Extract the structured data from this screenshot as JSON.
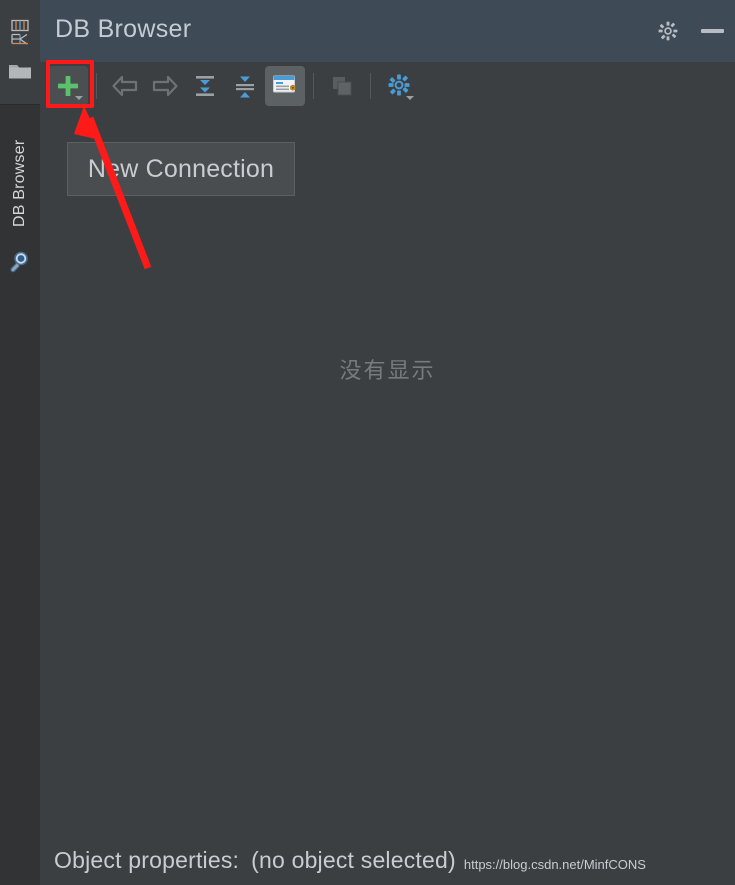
{
  "window": {
    "title": "DB Browser",
    "settings_icon": "gear-icon",
    "minimize_icon": "minimize-icon",
    "background": "#3c3f41",
    "titlebar_background": "#3f4a57"
  },
  "activity_bar": {
    "items": [
      {
        "icon": "database-tool-icon",
        "label": "Database"
      },
      {
        "icon": "folder-icon",
        "label": "Project Files"
      },
      {
        "icon": "search-everywhere-icon",
        "label": "Search"
      }
    ],
    "vertical_label": "DB Browser"
  },
  "toolbar": {
    "buttons": [
      {
        "id": "new-connection",
        "icon": "plus-icon",
        "label": "New Connection",
        "has_dropdown": true,
        "enabled": true,
        "state": "raised"
      },
      {
        "id": "separator-1",
        "icon": "separator",
        "label": ""
      },
      {
        "id": "back",
        "icon": "arrow-left-icon",
        "label": "Back",
        "enabled": false
      },
      {
        "id": "forward",
        "icon": "arrow-right-icon",
        "label": "Forward",
        "enabled": false
      },
      {
        "id": "expand-all",
        "icon": "expand-all-icon",
        "label": "Expand All",
        "enabled": true
      },
      {
        "id": "collapse-all",
        "icon": "collapse-all-icon",
        "label": "Collapse All",
        "enabled": true
      },
      {
        "id": "object-properties",
        "icon": "properties-window-icon",
        "label": "Object Properties",
        "enabled": true,
        "state": "active"
      },
      {
        "id": "separator-2",
        "icon": "separator",
        "label": ""
      },
      {
        "id": "duplicate",
        "icon": "copy-icon",
        "label": "Duplicate",
        "enabled": false
      },
      {
        "id": "separator-3",
        "icon": "separator",
        "label": ""
      },
      {
        "id": "options",
        "icon": "blue-gear-icon",
        "label": "Options",
        "has_dropdown": true,
        "enabled": true
      }
    ]
  },
  "tooltip": {
    "text": "New Connection",
    "visible": true
  },
  "annotation": {
    "highlight_color": "#ff1a1a",
    "arrow_color": "#ff1a1a",
    "target": "new-connection-button"
  },
  "content": {
    "empty_message": "没有显示"
  },
  "status_bar": {
    "label": "Object properties:",
    "value": "(no object selected)",
    "watermark": "https://blog.csdn.net/MinfCONS"
  }
}
